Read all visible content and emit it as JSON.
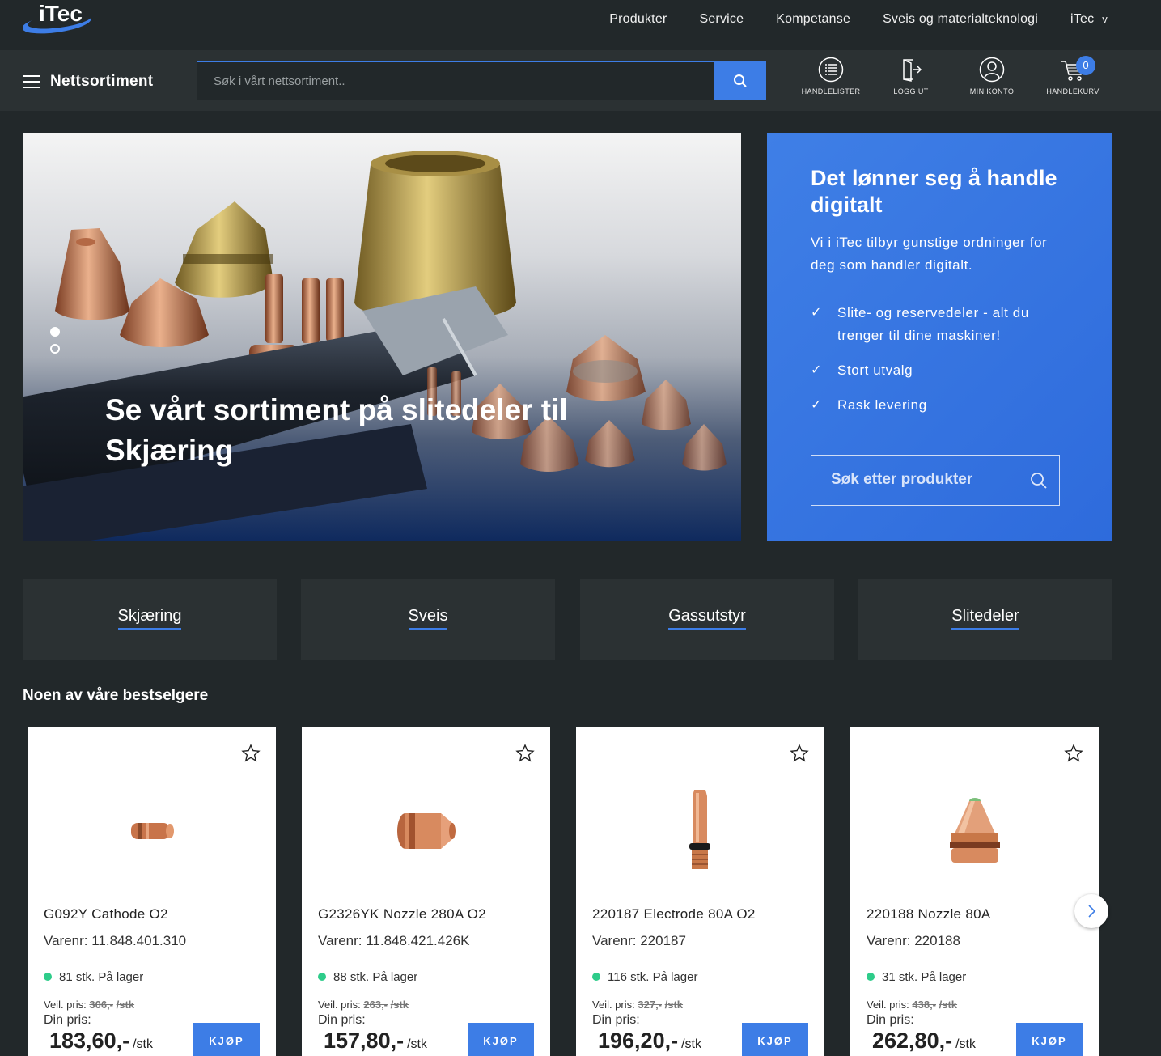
{
  "brand": {
    "logo_text": "iTec"
  },
  "topnav": {
    "items": [
      "Produkter",
      "Service",
      "Kompetanse",
      "Sveis og materialteknologi"
    ],
    "country": "iTec",
    "country_chevron": "v"
  },
  "mainbar": {
    "menu_label": "Nettsortiment",
    "search_placeholder": "Søk i vårt nettsortiment..",
    "utilities": [
      {
        "label": "HANDLELISTER",
        "icon": "list-icon"
      },
      {
        "label": "LOGG UT",
        "icon": "logout-icon"
      },
      {
        "label": "MIN KONTO",
        "icon": "user-icon"
      },
      {
        "label": "HANDLEKURV",
        "icon": "cart-icon"
      }
    ],
    "cart_count": "0"
  },
  "hero": {
    "title": "Se vårt sortiment på slitedeler til Skjæring",
    "slides": 2,
    "active_slide": 1
  },
  "promo": {
    "heading": "Det lønner seg å handle digitalt",
    "intro": "Vi i iTec tilbyr gunstige ordninger for deg som handler digitalt.",
    "bullets": [
      "Slite- og reservedeler - alt du trenger til dine maskiner!",
      "Stort utvalg",
      "Rask levering"
    ],
    "search_placeholder": "Søk etter produkter"
  },
  "categories": [
    "Skjæring",
    "Sveis",
    "Gassutstyr",
    "Slitedeler"
  ],
  "bestsellers": {
    "heading": "Noen av våre bestselgere",
    "veil_label": "Veil. pris:",
    "din_label": "Din pris:",
    "buy_label": "KJØP",
    "unit": "/stk",
    "products": [
      {
        "name": "G092Y Cathode O2",
        "sku": "Varenr: 11.848.401.310",
        "stock": "81 stk. På lager",
        "veil": "306,-",
        "price": "183,60,-"
      },
      {
        "name": "G2326YK Nozzle 280A O2",
        "sku": "Varenr: 11.848.421.426K",
        "stock": "88 stk. På lager",
        "veil": "263,-",
        "price": "157,80,-"
      },
      {
        "name": "220187 Electrode 80A O2",
        "sku": "Varenr: 220187",
        "stock": "116 stk. På lager",
        "veil": "327,-",
        "price": "196,20,-"
      },
      {
        "name": "220188 Nozzle 80A",
        "sku": "Varenr: 220188",
        "stock": "31 stk. På lager",
        "veil": "438,-",
        "price": "262,80,-"
      }
    ]
  },
  "colors": {
    "accent": "#3d7de6",
    "background": "#22282a",
    "in_stock": "#2ecc8a"
  }
}
